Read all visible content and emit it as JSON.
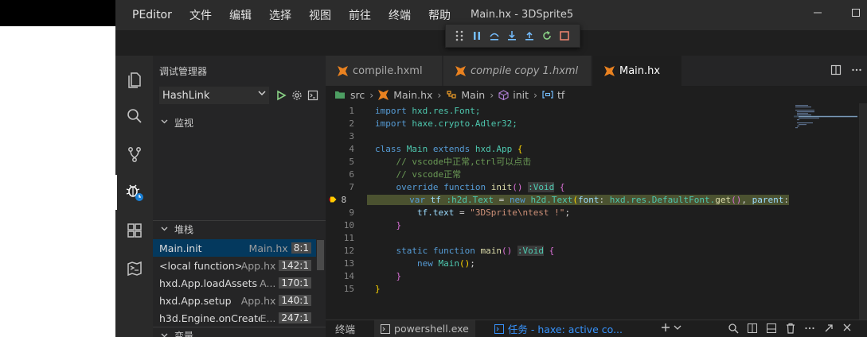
{
  "titlebar": {
    "app_name": "PEditor",
    "menu": [
      "文件",
      "编辑",
      "选择",
      "视图",
      "前往",
      "终端",
      "帮助"
    ],
    "window_title": "Main.hx - 3DSprite5"
  },
  "sidebar": {
    "title": "调试管理器",
    "config": "HashLink",
    "watch_header": "监视",
    "stack_header": "堆栈",
    "variables_header": "变量",
    "stack": [
      {
        "fn": "Main.init",
        "file": "Main.hx",
        "pos": "8:1"
      },
      {
        "fn": "<local function>",
        "file": "App.hx",
        "pos": "142:1"
      },
      {
        "fn": "hxd.App.loadAssets",
        "file": "A...",
        "pos": "170:1"
      },
      {
        "fn": "hxd.App.setup",
        "file": "App.hx",
        "pos": "140:1"
      },
      {
        "fn": "h3d.Engine.onCreate",
        "file": "E...",
        "pos": "247:1"
      }
    ]
  },
  "tabs": [
    {
      "label": "compile.hxml"
    },
    {
      "label": "compile copy 1.hxml"
    },
    {
      "label": "Main.hx"
    }
  ],
  "breadcrumb": [
    "src",
    "Main.hx",
    "Main",
    "init",
    "tf"
  ],
  "editor": {
    "line_numbers": [
      "1",
      "2",
      "3",
      "4",
      "5",
      "6",
      "7",
      "8",
      "9",
      "10",
      "11",
      "12",
      "13",
      "14",
      "15"
    ],
    "current_line": "8",
    "lines": {
      "l1_kw": "import",
      "l1_rest": " hxd.res.Font;",
      "l2_kw": "import",
      "l2_rest": " haxe.crypto.Adler32;",
      "l4_kw1": "class",
      "l4_name": "Main",
      "l4_kw2": "extends",
      "l4_rest": "hxd.App",
      "l5": "// vscode中正常,ctrl可以点击",
      "l6": "// vscode正常",
      "l7_kw1": "override",
      "l7_kw2": "function",
      "l7_fn": "init",
      "l7_ret": ":Void",
      "l8_kw": "var",
      "l8_var": "tf",
      "l8_type": ":h2d.Text",
      "l8_new": "new",
      "l8_ctor": "h2d.Text",
      "l8_arg1": "font",
      "l8_arg1v": "hxd.res.DefaultFont.",
      "l8_get": "get",
      "l8_arg2": "parent",
      "l9_var": "tf.text",
      "l9_str": "\"3DSprite\\ntest !\"",
      "l12_kw1": "static",
      "l12_kw2": "function",
      "l12_fn": "main",
      "l12_ret": ":Void",
      "l13_new": "new",
      "l13_ctor": "Main"
    }
  },
  "panel": {
    "tabs": [
      "终端",
      "powershell.exe",
      "任务 - haxe: active co..."
    ]
  },
  "colors": {
    "accent": "#3794ff",
    "selection": "#04395e",
    "debug_line": "#4b5230",
    "haxe_icon": "#ea8220"
  }
}
